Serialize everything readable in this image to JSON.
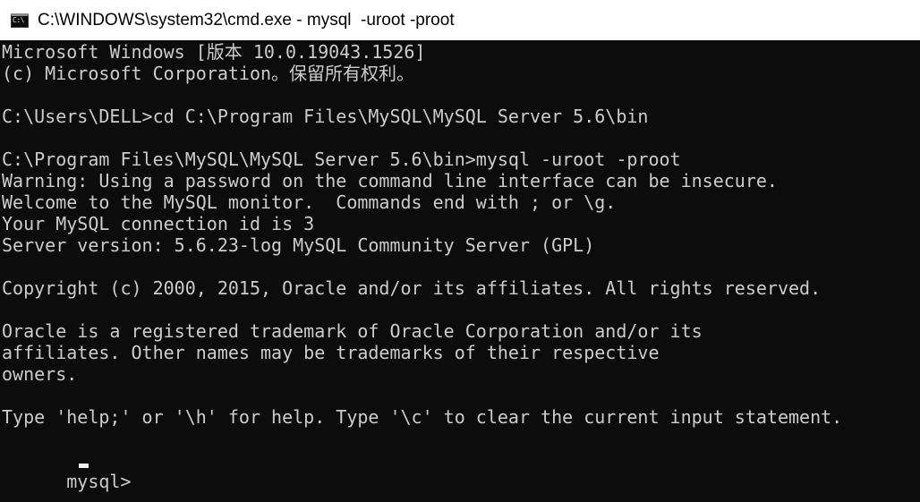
{
  "window": {
    "title": "C:\\WINDOWS\\system32\\cmd.exe - mysql  -uroot -proot",
    "icon": "cmd-icon",
    "icon_text": "C:\\"
  },
  "console": {
    "lines": [
      "Microsoft Windows [版本 10.0.19043.1526]",
      "(c) Microsoft Corporation。保留所有权利。",
      "",
      "C:\\Users\\DELL>cd C:\\Program Files\\MySQL\\MySQL Server 5.6\\bin",
      "",
      "C:\\Program Files\\MySQL\\MySQL Server 5.6\\bin>mysql -uroot -proot",
      "Warning: Using a password on the command line interface can be insecure.",
      "Welcome to the MySQL monitor.  Commands end with ; or \\g.",
      "Your MySQL connection id is 3",
      "Server version: 5.6.23-log MySQL Community Server (GPL)",
      "",
      "Copyright (c) 2000, 2015, Oracle and/or its affiliates. All rights reserved.",
      "",
      "Oracle is a registered trademark of Oracle Corporation and/or its",
      "affiliates. Other names may be trademarks of their respective",
      "owners.",
      "",
      "Type 'help;' or '\\h' for help. Type '\\c' to clear the current input statement.",
      ""
    ],
    "prompt": "mysql> "
  },
  "colors": {
    "console_background": "#0c0c0c",
    "console_text": "#cccccc",
    "titlebar_background": "#ffffff",
    "cursor": "#f2f2f2"
  }
}
